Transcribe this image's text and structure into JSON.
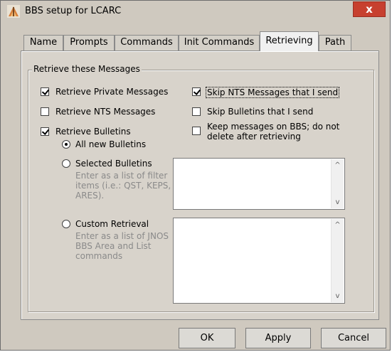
{
  "window": {
    "title": "BBS setup for LCARC",
    "close_label": "x"
  },
  "tabs": [
    {
      "label": "Name"
    },
    {
      "label": "Prompts"
    },
    {
      "label": "Commands"
    },
    {
      "label": "Init Commands"
    },
    {
      "label": "Retrieving",
      "active": true
    },
    {
      "label": "Path"
    }
  ],
  "group": {
    "label": "Retrieve these Messages"
  },
  "left_options": {
    "private": {
      "label": "Retrieve Private Messages",
      "checked": true
    },
    "nts": {
      "label": "Retrieve NTS Messages",
      "checked": false
    },
    "bulletins": {
      "label": "Retrieve Bulletins",
      "checked": true
    }
  },
  "right_options": {
    "skip_nts": {
      "label": "Skip NTS Messages that I send",
      "checked": true
    },
    "skip_bulletins": {
      "label": "Skip Bulletins that I send",
      "checked": false
    },
    "keep": {
      "label_line1": "Keep messages on BBS; do not",
      "label_line2": "delete after retrieving",
      "checked": false
    }
  },
  "bulletin_modes": {
    "all_new": {
      "label": "All new Bulletins",
      "selected": true
    },
    "selected": {
      "label": "Selected Bulletins",
      "hint_line1": "Enter as a list of filter",
      "hint_line2": "items (i.e.: QST, KEPS,",
      "hint_line3": "ARES).",
      "selected": false
    },
    "custom": {
      "label": "Custom Retrieval",
      "hint_line1": "Enter as a list of JNOS",
      "hint_line2": "BBS Area and List",
      "hint_line3": "commands",
      "selected": false
    }
  },
  "fields": {
    "selected_bulletins_value": "",
    "custom_retrieval_value": ""
  },
  "icons": {
    "scroll_up": "^",
    "scroll_down": "v"
  },
  "buttons": {
    "ok": "OK",
    "apply": "Apply",
    "cancel": "Cancel"
  }
}
